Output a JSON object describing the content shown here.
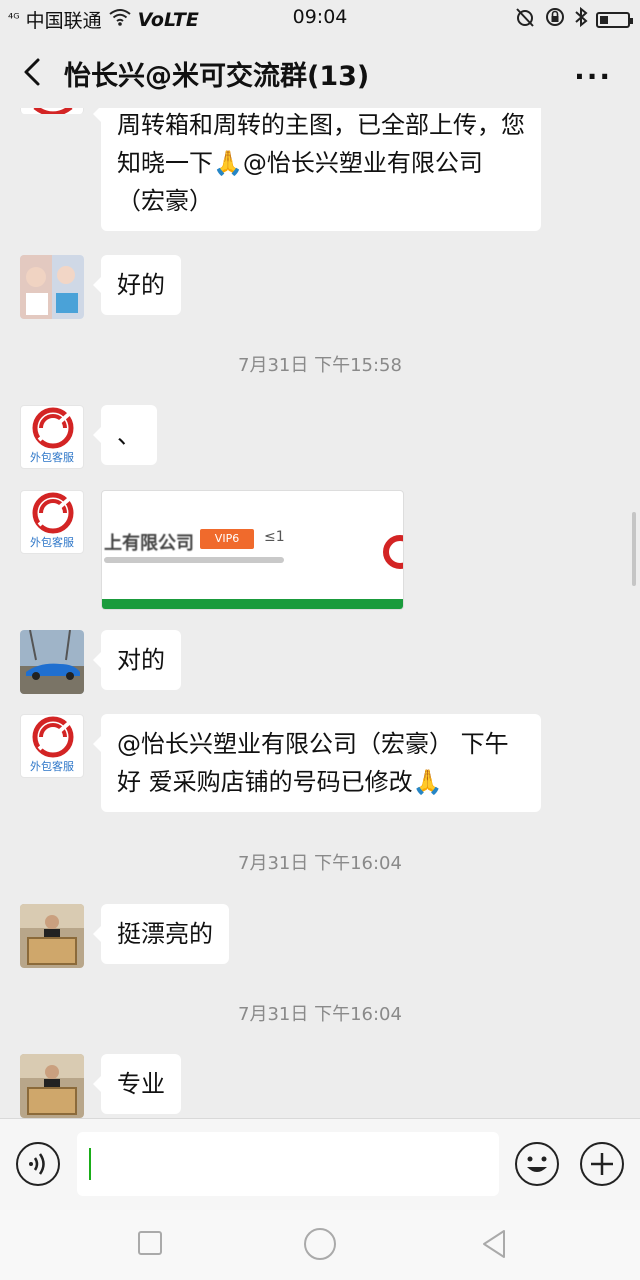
{
  "status_bar": {
    "signal": "⁴ᴳ",
    "carrier": "中国联通",
    "volte": "VoLTE",
    "time": "09:04"
  },
  "header": {
    "title": "怡长兴@米可交流群(13)",
    "back_icon": "chevron-left-icon",
    "more_icon": "more-icon"
  },
  "messages": {
    "m0": {
      "text": "周转箱和周转的主图，已全部上传，您知晓一下🙏@怡长兴塑业有限公司（宏豪）"
    },
    "m1": {
      "text": "好的"
    },
    "ts1": "7月31日 下午15:58",
    "m2": {
      "text": "、",
      "avatar_caption": "外包客服"
    },
    "m3": {
      "avatar_caption": "外包客服",
      "image_company": "上有限公司",
      "image_badge": "VIP6",
      "image_level": "≤1"
    },
    "m4": {
      "text": "对的"
    },
    "m5": {
      "text": "@怡长兴塑业有限公司（宏豪） 下午好   爱采购店铺的号码已修改🙏",
      "avatar_caption": "外包客服"
    },
    "ts2": "7月31日 下午16:04",
    "m6": {
      "text": "挺漂亮的"
    },
    "ts3": "7月31日 下午16:04",
    "m7": {
      "text": "专业"
    }
  },
  "input": {
    "value": "",
    "voice_icon": "voice-icon",
    "emoji_icon": "emoji-icon",
    "plus_icon": "plus-icon"
  },
  "colors": {
    "background": "#ededed",
    "bubble": "#ffffff",
    "accent_green": "#1aad19",
    "logo_red": "#d32424"
  }
}
